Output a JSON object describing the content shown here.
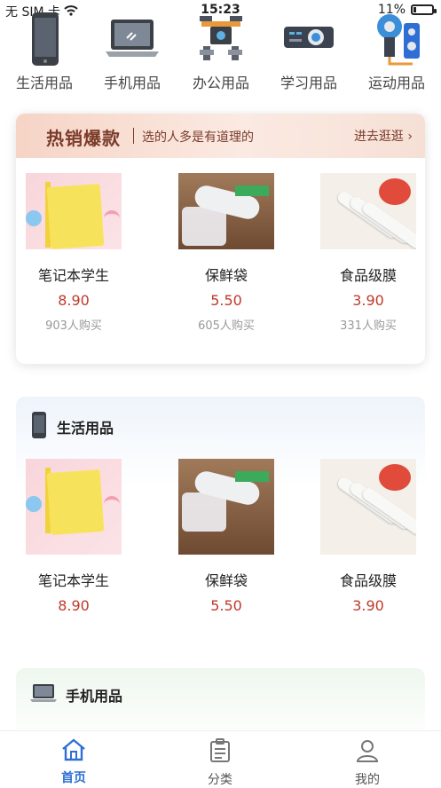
{
  "status": {
    "carrier": "无 SIM 卡",
    "time": "15:23",
    "battery": "11%"
  },
  "categories": [
    {
      "label": "生活用品",
      "icon": "phone-icon"
    },
    {
      "label": "手机用品",
      "icon": "laptop-icon"
    },
    {
      "label": "办公用品",
      "icon": "drone-icon"
    },
    {
      "label": "学习用品",
      "icon": "projector-icon"
    },
    {
      "label": "运动用品",
      "icon": "speaker-icon"
    }
  ],
  "hot": {
    "title": "热销爆款",
    "subtitle": "选的人多是有道理的",
    "link": "进去逛逛",
    "products": [
      {
        "name": "笔记本学生",
        "price": "8.90",
        "sold": "903人购买"
      },
      {
        "name": "保鲜袋",
        "price": "5.50",
        "sold": "605人购买"
      },
      {
        "name": "食品级膜",
        "price": "3.90",
        "sold": "331人购买"
      }
    ]
  },
  "sections": [
    {
      "title": "生活用品",
      "products": [
        {
          "name": "笔记本学生",
          "price": "8.90"
        },
        {
          "name": "保鲜袋",
          "price": "5.50"
        },
        {
          "name": "食品级膜",
          "price": "3.90"
        }
      ]
    },
    {
      "title": "手机用品"
    }
  ],
  "tabs": [
    {
      "label": "首页"
    },
    {
      "label": "分类"
    },
    {
      "label": "我的"
    }
  ],
  "colors": {
    "accent": "#2f6fd4",
    "price": "#c0392b"
  }
}
